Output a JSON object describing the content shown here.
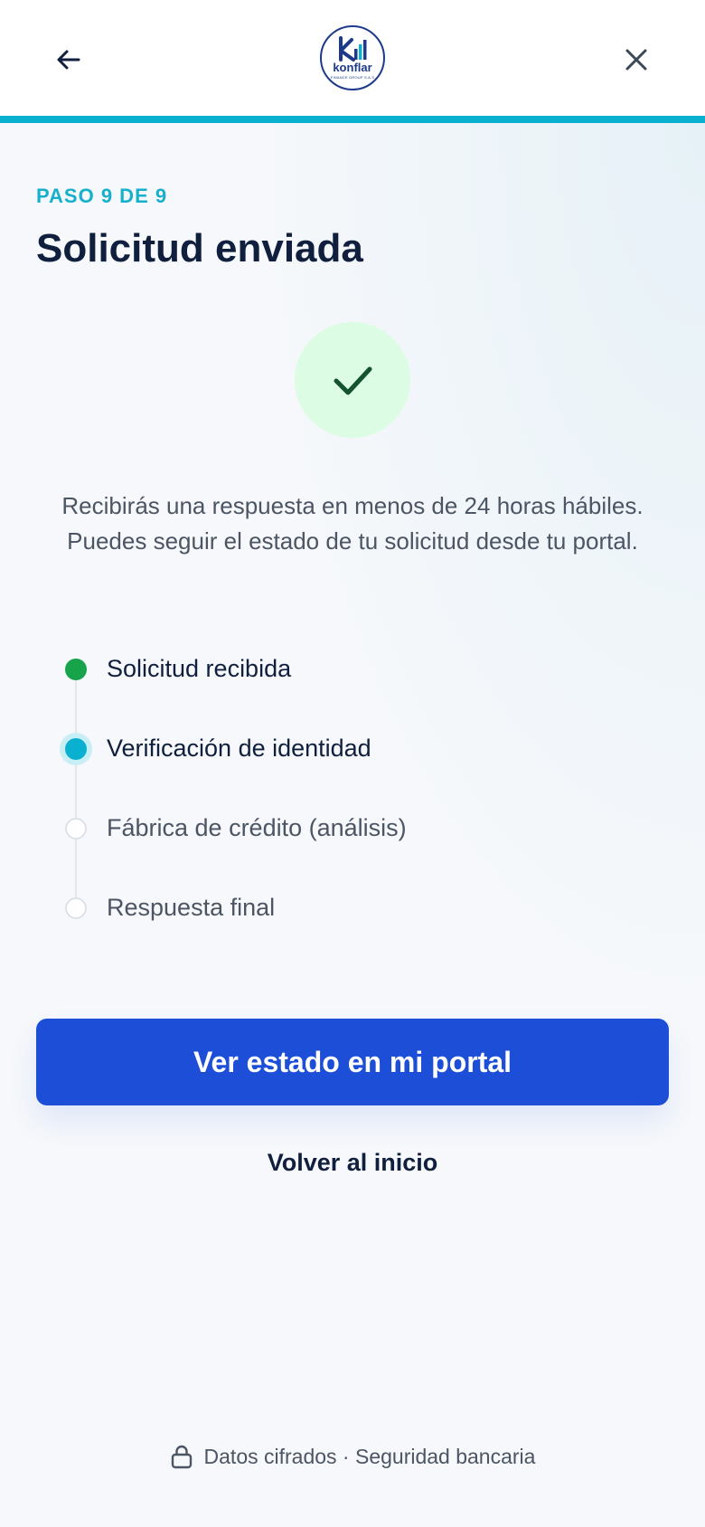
{
  "header": {
    "logo_text": "konflar",
    "logo_subtext": "FINANCE GROUP S.A.S"
  },
  "step": {
    "label": "PASO 9 DE 9"
  },
  "page": {
    "title": "Solicitud enviada",
    "message": "Recibirás una respuesta en menos de 24 horas hábiles. Puedes seguir el estado de tu solicitud desde tu portal."
  },
  "timeline": {
    "items": [
      {
        "label": "Solicitud recibida",
        "status": "done"
      },
      {
        "label": "Verificación de identidad",
        "status": "active"
      },
      {
        "label": "Fábrica de crédito (análisis)",
        "status": "pending"
      },
      {
        "label": "Respuesta final",
        "status": "pending"
      }
    ]
  },
  "actions": {
    "primary_label": "Ver estado en mi portal",
    "secondary_label": "Volver al inicio"
  },
  "footer": {
    "text": "Datos cifrados · Seguridad bancaria"
  },
  "colors": {
    "accent": "#0ab0cf",
    "primary": "#1d4ed8",
    "success": "#16a34a",
    "success_bg": "#dcfce3",
    "text_dark": "#0f1f3d"
  },
  "icons": {
    "back": "arrow-left-icon",
    "close": "close-icon",
    "success": "check-icon",
    "lock": "lock-icon"
  }
}
